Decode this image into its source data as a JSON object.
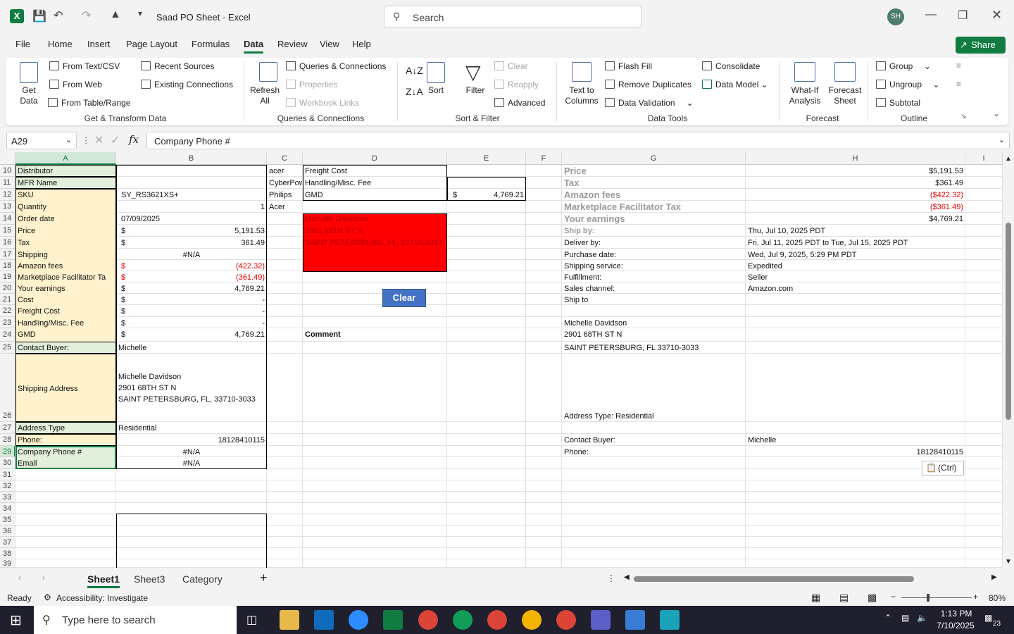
{
  "title_bar": {
    "file_title": "Saad PO Sheet  -  Excel",
    "search_placeholder": "Search",
    "avatar": "SH"
  },
  "menu": {
    "items": [
      "File",
      "Home",
      "Insert",
      "Page Layout",
      "Formulas",
      "Data",
      "Review",
      "View",
      "Help"
    ],
    "active": "Data",
    "share": "Share"
  },
  "ribbon": {
    "get_data": "Get Data",
    "from_text": "From Text/CSV",
    "from_web": "From Web",
    "from_table": "From Table/Range",
    "recent_sources": "Recent Sources",
    "existing_connections": "Existing Connections",
    "group_get": "Get & Transform Data",
    "refresh_all": "Refresh All",
    "queries": "Queries & Connections",
    "properties": "Properties",
    "workbook_links": "Workbook Links",
    "group_queries": "Queries & Connections",
    "sort": "Sort",
    "filter": "Filter",
    "clear": "Clear",
    "reapply": "Reapply",
    "advanced": "Advanced",
    "group_sort": "Sort & Filter",
    "text_to_columns": "Text to Columns",
    "flash_fill": "Flash Fill",
    "remove_duplicates": "Remove Duplicates",
    "data_validation": "Data Validation",
    "consolidate": "Consolidate",
    "data_model": "Data Model",
    "group_tools": "Data Tools",
    "what_if": "What-If Analysis",
    "forecast_sheet": "Forecast Sheet",
    "group_forecast": "Forecast",
    "group": "Group",
    "ungroup": "Ungroup",
    "subtotal": "Subtotal",
    "group_outline": "Outline"
  },
  "formula_bar": {
    "name_box": "A29",
    "formula": "Company Phone #"
  },
  "columns": [
    "A",
    "B",
    "C",
    "D",
    "E",
    "F",
    "G",
    "H",
    "I"
  ],
  "rows": [
    "10",
    "11",
    "12",
    "13",
    "14",
    "15",
    "16",
    "17",
    "18",
    "19",
    "20",
    "21",
    "22",
    "23",
    "24",
    "25",
    "26",
    "27",
    "28",
    "29",
    "30",
    "31",
    "32",
    "33",
    "34",
    "35",
    "36",
    "37",
    "38",
    "39"
  ],
  "cells": {
    "a10": "Distributor",
    "a11": "MFR Name",
    "a12": "SKU",
    "a13": "Quantity",
    "a14": "Order date",
    "a15": "Price",
    "a16": "Tax",
    "a17": "Shipping",
    "a18": "Amazon fees",
    "a19": "Marketplace Facilitator Ta",
    "a20": "Your earnings",
    "a21": "Cost",
    "a22": "Freight Cost",
    "a23": "Handling/Misc. Fee",
    "a24": "GMD",
    "a25": "Contact Buyer:",
    "a26": "Shipping Address",
    "a27": "Address Type",
    "a28": "Phone:",
    "a29": "Company Phone #",
    "a30": "Email",
    "b12": "SY_RS3621XS+",
    "b13": "1",
    "b14": "07/09/2025",
    "cur": "$",
    "b15": "5,191.53",
    "b16": "361.49",
    "b17": "#N/A",
    "b18": "(422.32)",
    "b19": "(361.49)",
    "b20": "4,769.21",
    "b21": "-",
    "b22": "-",
    "b23": "-",
    "b24": "4,769.21",
    "b25": "Michelle",
    "b26_1": "Michelle Davidson",
    "b26_2": "2901 68TH ST N",
    "b26_3": "SAINT PETERSBURG, FL, 33710-3033",
    "b27": "Residential",
    "b28": "18128410115",
    "b29": "#N/A",
    "b30": "#N/A",
    "c10": "acer",
    "c11": "CyberPow",
    "c12": "Philips",
    "c13": "Acer",
    "d10": "Freight Cost",
    "d11": "Handling/Misc. Fee",
    "d12": "GMD",
    "e12": "4,769.21",
    "d14": "Michelle Davidson",
    "d15": "2901 68TH ST N",
    "d16": "SAINT PETERSBURG, FL, 33710-3033",
    "clear_btn": "Clear",
    "d24": "Comment",
    "g10": "Price",
    "h10": "$5,191.53",
    "g11": "Tax",
    "h11": "$361.49",
    "g12": "Amazon fees",
    "h12": "($422.32)",
    "g13": "Marketplace Facilitator Tax",
    "h13": "($361.49)",
    "g14": "Your earnings",
    "h14": "$4,769.21",
    "g15": "Ship by:",
    "h15": "Thu, Jul 10, 2025 PDT",
    "g16": "Deliver by:",
    "h16": "Fri, Jul 11, 2025 PDT to Tue, Jul 15, 2025 PDT",
    "g17": "Purchase date:",
    "h17": "Wed, Jul 9, 2025, 5:29 PM PDT",
    "g18": "Shipping service:",
    "h18": "Expedited",
    "g19": "Fulfillment:",
    "h19": "Seller",
    "g20": "Sales channel:",
    "h20": "Amazon.com",
    "g21": "Ship to",
    "g23": "Michelle Davidson",
    "g24": "2901 68TH ST N",
    "g25": "SAINT PETERSBURG, FL 33710-3033",
    "g26": "Address Type:  Residential",
    "g28": "Contact Buyer:",
    "h28": "Michelle",
    "g29": "Phone:",
    "h29": "18128410115",
    "paste_ctrl": "(Ctrl)"
  },
  "sheets": {
    "tabs": [
      "Sheet1",
      "Sheet3",
      "Category"
    ],
    "active": "Sheet1"
  },
  "status": {
    "ready": "Ready",
    "accessibility": "Accessibility: Investigate",
    "zoom": "80%"
  },
  "taskbar": {
    "search": "Type here to search",
    "time": "1:13 PM",
    "date": "7/10/2025",
    "notif": "23"
  }
}
